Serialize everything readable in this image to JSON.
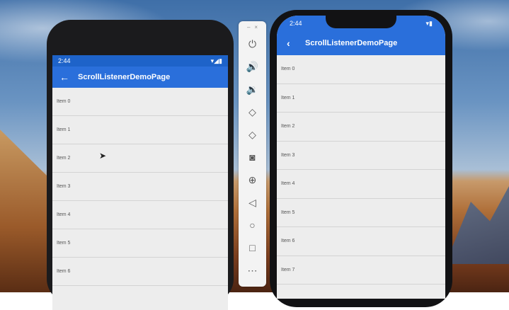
{
  "android": {
    "status_time": "2:44",
    "status_icons": "▾◢▮",
    "title": "ScrollListenerDemoPage",
    "back_icon": "back-arrow-icon",
    "items": [
      "Item 0",
      "Item 1",
      "Item 2",
      "Item 3",
      "Item 4",
      "Item 5",
      "Item 6"
    ]
  },
  "iphone": {
    "status_time": "2:44",
    "status_icons": "▾▮",
    "title": "ScrollListenerDemoPage",
    "back_icon": "chevron-left-icon",
    "items": [
      "Item 0",
      "Item 1",
      "Item 2",
      "Item 3",
      "Item 4",
      "Item 5",
      "Item 6",
      "Item 7"
    ]
  },
  "toolbar": {
    "buttons": [
      {
        "icon": "power-icon",
        "glyph": "⏻"
      },
      {
        "icon": "volume-up-icon",
        "glyph": "🔊"
      },
      {
        "icon": "volume-down-icon",
        "glyph": "🔉"
      },
      {
        "icon": "rotate-left-icon",
        "glyph": "◇"
      },
      {
        "icon": "rotate-right-icon",
        "glyph": "◇"
      },
      {
        "icon": "camera-icon",
        "glyph": "◙"
      },
      {
        "icon": "zoom-icon",
        "glyph": "⊕"
      },
      {
        "icon": "back-icon",
        "glyph": "◁"
      },
      {
        "icon": "home-icon",
        "glyph": "○"
      },
      {
        "icon": "overview-icon",
        "glyph": "□"
      },
      {
        "icon": "more-icon",
        "glyph": "⋯"
      }
    ]
  }
}
